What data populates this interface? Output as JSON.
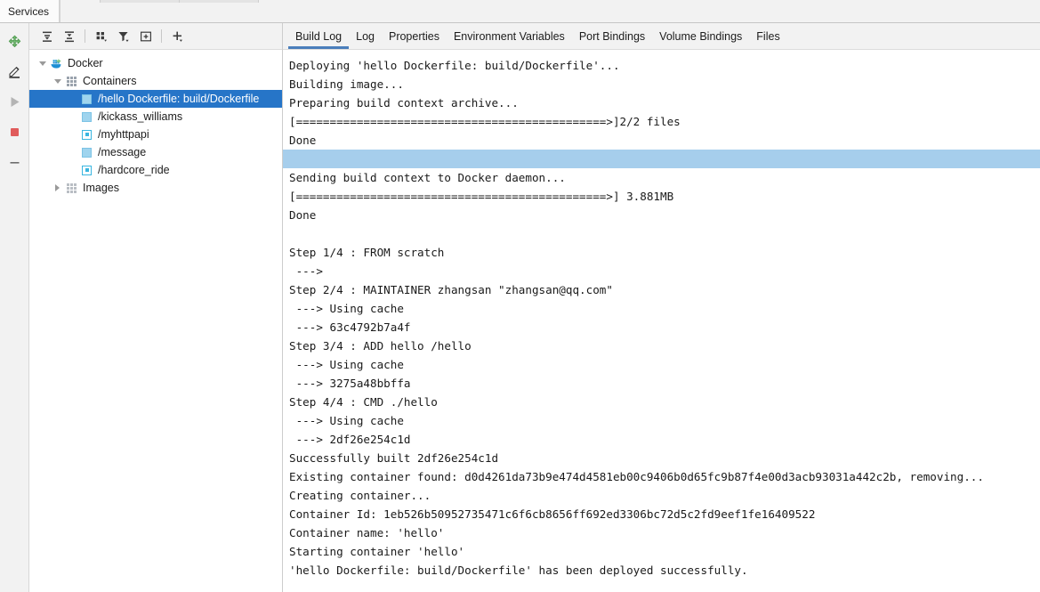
{
  "window": {
    "tabs": [
      {
        "label": "Services",
        "active": true
      }
    ]
  },
  "vertical_toolbar": {
    "buttons": [
      {
        "name": "connect-icon",
        "title": "Connect"
      },
      {
        "name": "edit-pencil-icon",
        "title": "Edit Configuration"
      },
      {
        "name": "run-play-icon",
        "title": "Run"
      },
      {
        "name": "stop-square-icon",
        "title": "Stop"
      },
      {
        "name": "minus-icon",
        "title": "Remove"
      }
    ]
  },
  "tree_toolbar": {
    "buttons": [
      {
        "name": "expand-all-icon",
        "title": "Expand All"
      },
      {
        "name": "collapse-all-icon",
        "title": "Collapse All"
      },
      {
        "name": "group-icon",
        "title": "Group"
      },
      {
        "name": "filter-icon",
        "title": "Filter"
      },
      {
        "name": "add-frame-icon",
        "title": "Add Tab"
      },
      {
        "name": "plus-icon",
        "title": "Add Service"
      }
    ]
  },
  "tree": {
    "nodes": [
      {
        "label": "Docker",
        "icon": "docker-whale-icon",
        "indent": 0,
        "twisty": "down",
        "selected": false
      },
      {
        "label": "Containers",
        "icon": "containers-grid-icon",
        "indent": 1,
        "twisty": "down",
        "selected": false
      },
      {
        "label": "/hello Dockerfile: build/Dockerfile",
        "icon": "container-stopped-icon",
        "indent": 2,
        "twisty": "none",
        "selected": true
      },
      {
        "label": "/kickass_williams",
        "icon": "container-stopped-icon",
        "indent": 2,
        "twisty": "none",
        "selected": false
      },
      {
        "label": "/myhttpapi",
        "icon": "container-running-icon",
        "indent": 2,
        "twisty": "none",
        "selected": false
      },
      {
        "label": "/message",
        "icon": "container-stopped-icon",
        "indent": 2,
        "twisty": "none",
        "selected": false
      },
      {
        "label": "/hardcore_ride",
        "icon": "container-running-icon",
        "indent": 2,
        "twisty": "none",
        "selected": false
      },
      {
        "label": "Images",
        "icon": "images-grid-icon",
        "indent": 1,
        "twisty": "right",
        "selected": false
      }
    ]
  },
  "content_tabs": [
    {
      "label": "Build Log",
      "active": true
    },
    {
      "label": "Log",
      "active": false
    },
    {
      "label": "Properties",
      "active": false
    },
    {
      "label": "Environment Variables",
      "active": false
    },
    {
      "label": "Port Bindings",
      "active": false
    },
    {
      "label": "Volume Bindings",
      "active": false
    },
    {
      "label": "Files",
      "active": false
    }
  ],
  "build_log": {
    "lines": [
      {
        "text": "Deploying 'hello Dockerfile: build/Dockerfile'...",
        "highlight": false
      },
      {
        "text": "Building image...",
        "highlight": false
      },
      {
        "text": "Preparing build context archive...",
        "highlight": false
      },
      {
        "text": "[==============================================>]2/2 files",
        "highlight": false
      },
      {
        "text": "Done",
        "highlight": false
      },
      {
        "text": "",
        "highlight": true
      },
      {
        "text": "Sending build context to Docker daemon...",
        "highlight": false
      },
      {
        "text": "[==============================================>] 3.881MB",
        "highlight": false
      },
      {
        "text": "Done",
        "highlight": false
      },
      {
        "text": "",
        "highlight": false
      },
      {
        "text": "Step 1/4 : FROM scratch",
        "highlight": false
      },
      {
        "text": " --->",
        "highlight": false
      },
      {
        "text": "Step 2/4 : MAINTAINER zhangsan \"zhangsan@qq.com\"",
        "highlight": false
      },
      {
        "text": " ---> Using cache",
        "highlight": false
      },
      {
        "text": " ---> 63c4792b7a4f",
        "highlight": false
      },
      {
        "text": "Step 3/4 : ADD hello /hello",
        "highlight": false
      },
      {
        "text": " ---> Using cache",
        "highlight": false
      },
      {
        "text": " ---> 3275a48bbffa",
        "highlight": false
      },
      {
        "text": "Step 4/4 : CMD ./hello",
        "highlight": false
      },
      {
        "text": " ---> Using cache",
        "highlight": false
      },
      {
        "text": " ---> 2df26e254c1d",
        "highlight": false
      },
      {
        "text": "Successfully built 2df26e254c1d",
        "highlight": false
      },
      {
        "text": "Existing container found: d0d4261da73b9e474d4581eb00c9406b0d65fc9b87f4e00d3acb93031a442c2b, removing...",
        "highlight": false
      },
      {
        "text": "Creating container...",
        "highlight": false
      },
      {
        "text": "Container Id: 1eb526b50952735471c6f6cb8656ff692ed3306bc72d5c2fd9eef1fe16409522",
        "highlight": false
      },
      {
        "text": "Container name: 'hello'",
        "highlight": false
      },
      {
        "text": "Starting container 'hello'",
        "highlight": false
      },
      {
        "text": "'hello Dockerfile: build/Dockerfile' has been deployed successfully.",
        "highlight": false
      }
    ]
  },
  "colors": {
    "selection_blue": "#2675c8",
    "log_highlight": "#a6ceec",
    "tab_underline": "#4a7ebb",
    "toolbar_bg": "#f2f2f2",
    "docker_blue": "#1d8fd4",
    "run_green": "#59a869",
    "stop_red": "#db5860"
  }
}
